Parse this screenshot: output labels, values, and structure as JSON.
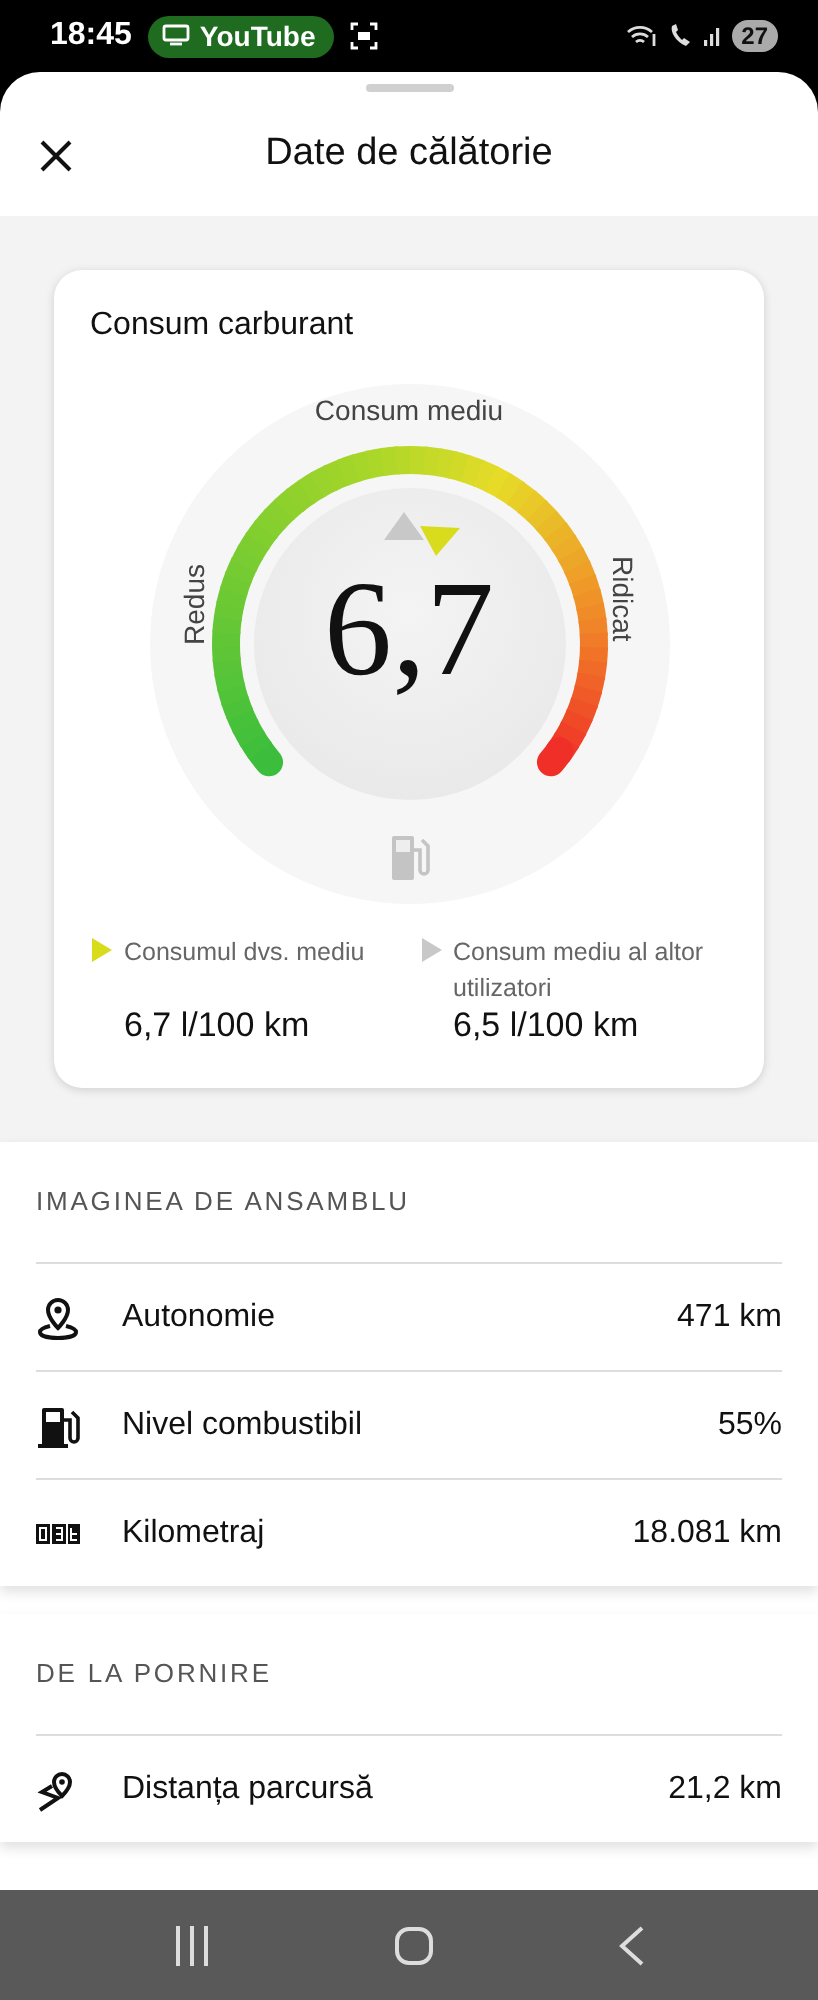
{
  "status_bar": {
    "time": "18:45",
    "app_chip": "YouTube",
    "battery": "27"
  },
  "header": {
    "title": "Date de călătorie"
  },
  "fuel_card": {
    "title": "Consum carburant",
    "gauge": {
      "top_label": "Consum mediu",
      "left_label": "Redus",
      "right_label": "Ridicat",
      "value": "6,7"
    },
    "legend": [
      {
        "label": "Consumul dvs. mediu",
        "value": "6,7 l/100 km",
        "color": "#d9dc1c"
      },
      {
        "label": "Consum mediu al altor utilizatori",
        "value": "6,5 l/100 km",
        "color": "#c8c8c8"
      }
    ]
  },
  "sections": [
    {
      "title": "IMAGINEA DE ANSAMBLU",
      "rows": [
        {
          "kind": "pin",
          "label": "Autonomie",
          "value": "471 km"
        },
        {
          "kind": "fuel",
          "label": "Nivel combustibil",
          "value": "55%"
        },
        {
          "kind": "odometer",
          "label": "Kilometraj",
          "value": "18.081 km"
        }
      ]
    },
    {
      "title": "DE LA PORNIRE",
      "rows": [
        {
          "kind": "route",
          "label": "Distanța parcursă",
          "value": "21,2 km"
        }
      ]
    }
  ]
}
